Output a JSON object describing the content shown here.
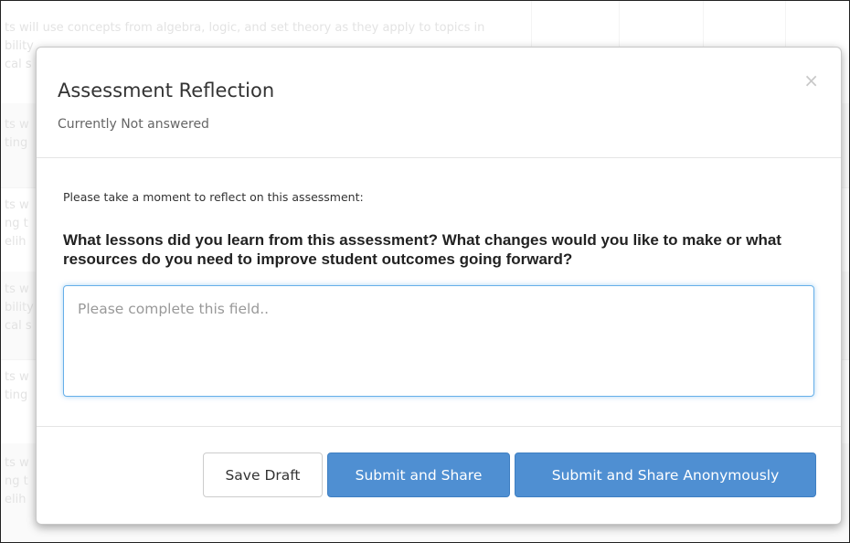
{
  "background": {
    "rows": [
      {
        "lines": [
          "ts will use concepts from algebra, logic, and set theory as they apply to topics in",
          "bility",
          "cal s"
        ]
      },
      {
        "lines": [
          "ts w",
          "ting"
        ]
      },
      {
        "lines": [
          "ts w",
          "ng t",
          "elih"
        ]
      },
      {
        "lines": [
          "ts w",
          "bility",
          "cal s"
        ]
      },
      {
        "lines": [
          "ts w",
          "ting"
        ]
      },
      {
        "lines": [
          "ts w",
          "ng t",
          "elih"
        ]
      }
    ]
  },
  "modal": {
    "title": "Assessment Reflection",
    "subtitle": "Currently Not answered",
    "close_symbol": "×",
    "prompt": "Please take a moment to reflect on this assessment:",
    "question": "What lessons did you learn from this assessment? What changes would you like to make or what resources do you need to improve student outcomes going forward?",
    "answer": {
      "value": "",
      "placeholder": "Please complete this field.."
    },
    "buttons": {
      "save_draft": "Save Draft",
      "submit_share": "Submit and Share",
      "submit_anonymous": "Submit and Share Anonymously"
    }
  },
  "colors": {
    "primary": "#4f8fd2",
    "focus_border": "#66afe9"
  }
}
